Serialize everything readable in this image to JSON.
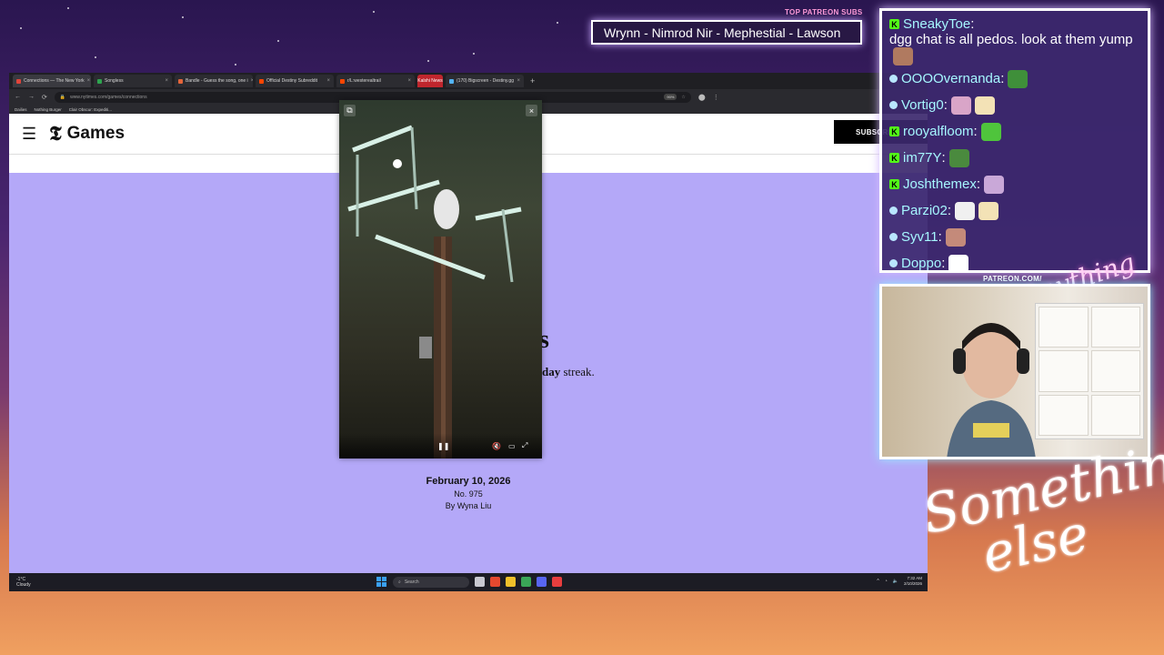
{
  "browser": {
    "tabs": [
      {
        "label": "Connections — The New York",
        "color": "#e0443a",
        "active": true
      },
      {
        "label": "Songless",
        "color": "#2ea44f"
      },
      {
        "label": "Bandle - Guess the song, one i",
        "color": "#e4653a"
      },
      {
        "label": "Official Destiny Subreddit",
        "color": "#ff4500"
      },
      {
        "label": "r/L:westerealtrail",
        "color": "#ff4500"
      },
      {
        "label": "Kalshi News",
        "color": "#c0262d",
        "news": true
      },
      {
        "label": "(170) Bigscreen - Destiny.gg",
        "color": "#53b3f5"
      }
    ],
    "new_tab": "+",
    "url": "www.nytimes.com/games/connections",
    "zoom": "90%",
    "bookmarks": [
      "Dailies",
      "Nothing Burger",
      "Clair Obscur: Expediti..."
    ]
  },
  "nyt": {
    "logo": "𝕿",
    "section": "Games",
    "subscribe": "SUBSCRIBE",
    "title_fragment": "s",
    "streak_bold": "day",
    "streak_rest": " streak.",
    "date": "February 10, 2026",
    "puzzle_number": "No. 975",
    "byline": "By Wyna Liu"
  },
  "taskbar": {
    "weather_temp": "-1°C",
    "weather_desc": "Cloudy",
    "search_placeholder": "Search",
    "time": "7:32 AM",
    "date": "2/10/2026"
  },
  "overlay": {
    "patreon_header": "TOP PATREON SUBS",
    "patreon_ticker": "Wrynn - Nimrod Nir - Mephestial - Lawson",
    "webcam_label": "PATREON.COM/",
    "signature_small": "Anything else?",
    "signature_big": "Something else"
  },
  "chat": [
    {
      "platform": "kick",
      "user": "SneakyToe",
      "msg": "dgg chat is all pedos. look at them yump",
      "emotes": [
        "#b07a60"
      ]
    },
    {
      "platform": "twitch",
      "user": "OOOOvernanda",
      "msg": "",
      "emotes": [
        "#3f8f3a"
      ]
    },
    {
      "platform": "twitch",
      "user": "Vortig0",
      "msg": "",
      "emotes": [
        "#d9a5c8",
        "#f3e2b6"
      ]
    },
    {
      "platform": "kick",
      "user": "rooyalfloom",
      "msg": "",
      "emotes": [
        "#4fc43c"
      ]
    },
    {
      "platform": "kick",
      "user": "im77Y",
      "msg": "",
      "emotes": [
        "#4a8a3e"
      ]
    },
    {
      "platform": "kick",
      "user": "Joshthemex",
      "msg": "",
      "emotes": [
        "#c9a8d8"
      ]
    },
    {
      "platform": "twitch",
      "user": "Parzi02",
      "msg": "",
      "emotes": [
        "#f0f0f0",
        "#f3e2b6"
      ]
    },
    {
      "platform": "twitch",
      "user": "Syv11",
      "msg": "",
      "emotes": [
        "#c48a7a"
      ]
    },
    {
      "platform": "twitch",
      "user": "Doppo",
      "msg": "",
      "emotes": [
        "#ffffff"
      ]
    }
  ]
}
